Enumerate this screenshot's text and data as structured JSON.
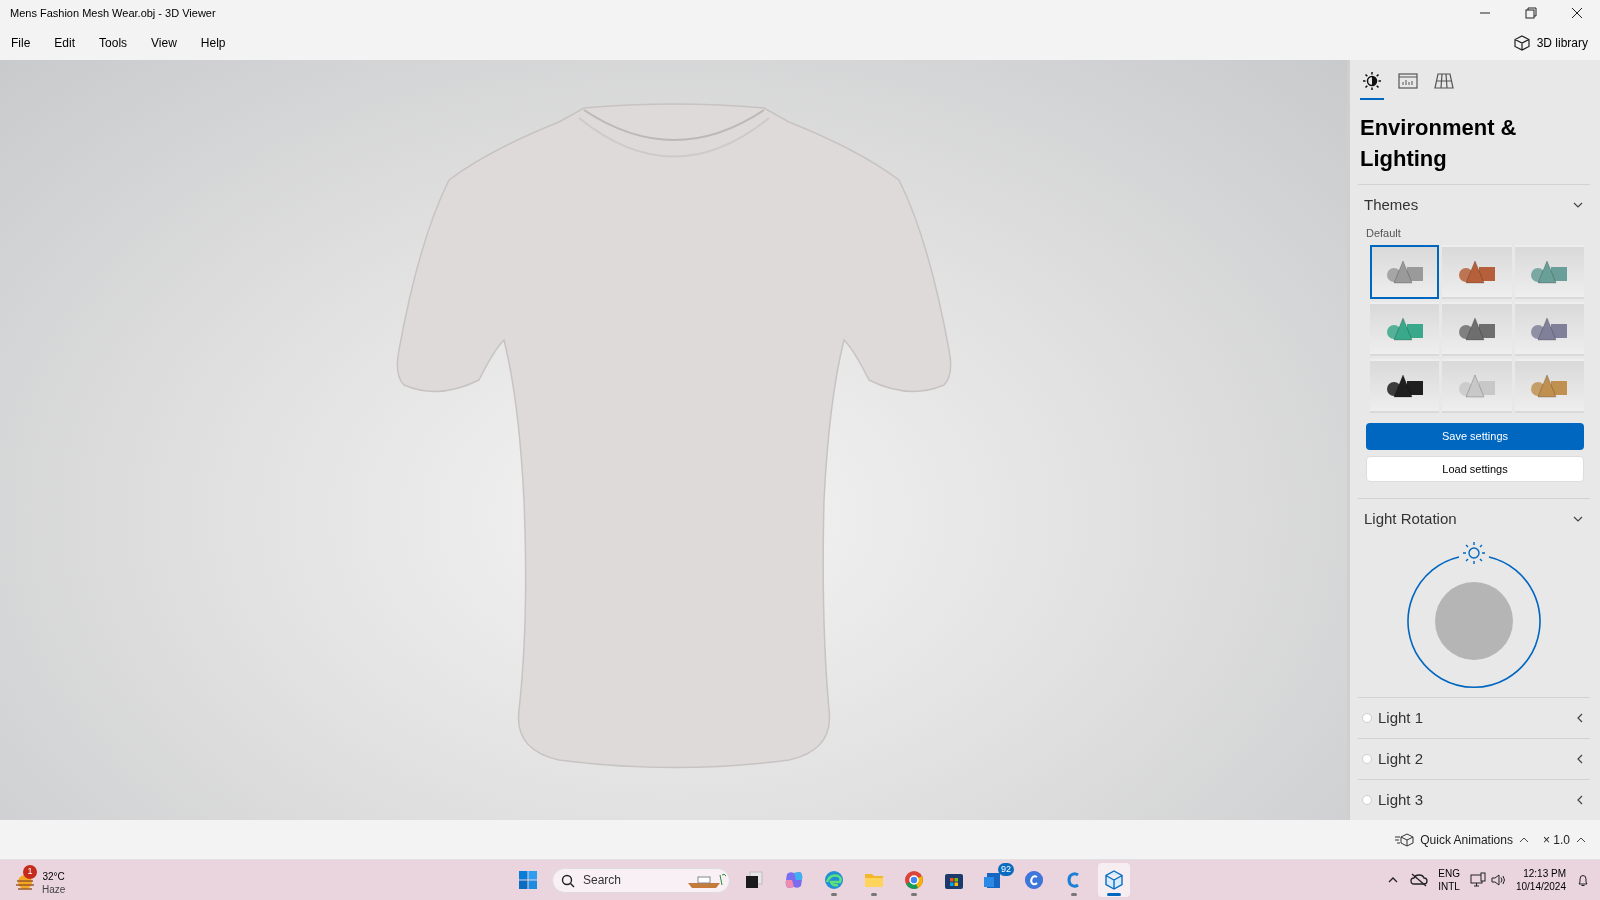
{
  "window": {
    "title": "Mens Fashion Mesh Wear.obj - 3D Viewer"
  },
  "menu": [
    "File",
    "Edit",
    "Tools",
    "View",
    "Help"
  ],
  "library_button": "3D library",
  "panel": {
    "tabs": [
      {
        "kind": "lighting",
        "selected": true
      },
      {
        "kind": "stats",
        "selected": false
      },
      {
        "kind": "grid",
        "selected": false
      }
    ],
    "heading": "Environment & Lighting",
    "themes": {
      "title": "Themes",
      "expanded": true,
      "label": "Default",
      "items": [
        {
          "color": "#9a9a9a",
          "selected": true
        },
        {
          "color": "#b5603a",
          "selected": false
        },
        {
          "color": "#6a9e98",
          "selected": false
        },
        {
          "color": "#3aa88a",
          "selected": false
        },
        {
          "color": "#6e6e6e",
          "selected": false
        },
        {
          "color": "#80809a",
          "selected": false
        },
        {
          "color": "#1f1f1f",
          "selected": false
        },
        {
          "color": "#c8c8c8",
          "selected": false
        },
        {
          "color": "#c09050",
          "selected": false
        }
      ],
      "save": "Save settings",
      "load": "Load settings"
    },
    "rotation": {
      "title": "Light Rotation",
      "expanded": true
    },
    "lights": [
      {
        "label": "Light 1",
        "on": false
      },
      {
        "label": "Light 2",
        "on": false
      },
      {
        "label": "Light 3",
        "on": false
      }
    ]
  },
  "bottom_bar": {
    "animations": "Quick Animations",
    "speed": "× 1.0"
  },
  "taskbar": {
    "weather": {
      "badge": "1",
      "temp": "32°C",
      "condition": "Haze"
    },
    "search": {
      "placeholder": "Search"
    },
    "apps": [
      {
        "kind": "start",
        "running": false,
        "selected": false
      },
      {
        "kind": "taskview",
        "running": false,
        "selected": false
      },
      {
        "kind": "copilot",
        "running": false,
        "selected": false
      },
      {
        "kind": "edge",
        "running": true,
        "selected": false
      },
      {
        "kind": "files",
        "running": true,
        "selected": false
      },
      {
        "kind": "chrome",
        "running": true,
        "selected": false
      },
      {
        "kind": "store",
        "running": false,
        "selected": false
      },
      {
        "kind": "mail",
        "running": false,
        "selected": false,
        "badge": "92"
      },
      {
        "kind": "canva",
        "running": false,
        "selected": false
      },
      {
        "kind": "cc",
        "running": true,
        "selected": false
      },
      {
        "kind": "viewer",
        "running": true,
        "selected": true
      }
    ],
    "language": [
      "ENG",
      "INTL"
    ],
    "time": "12:13 PM",
    "date": "10/14/2024"
  }
}
